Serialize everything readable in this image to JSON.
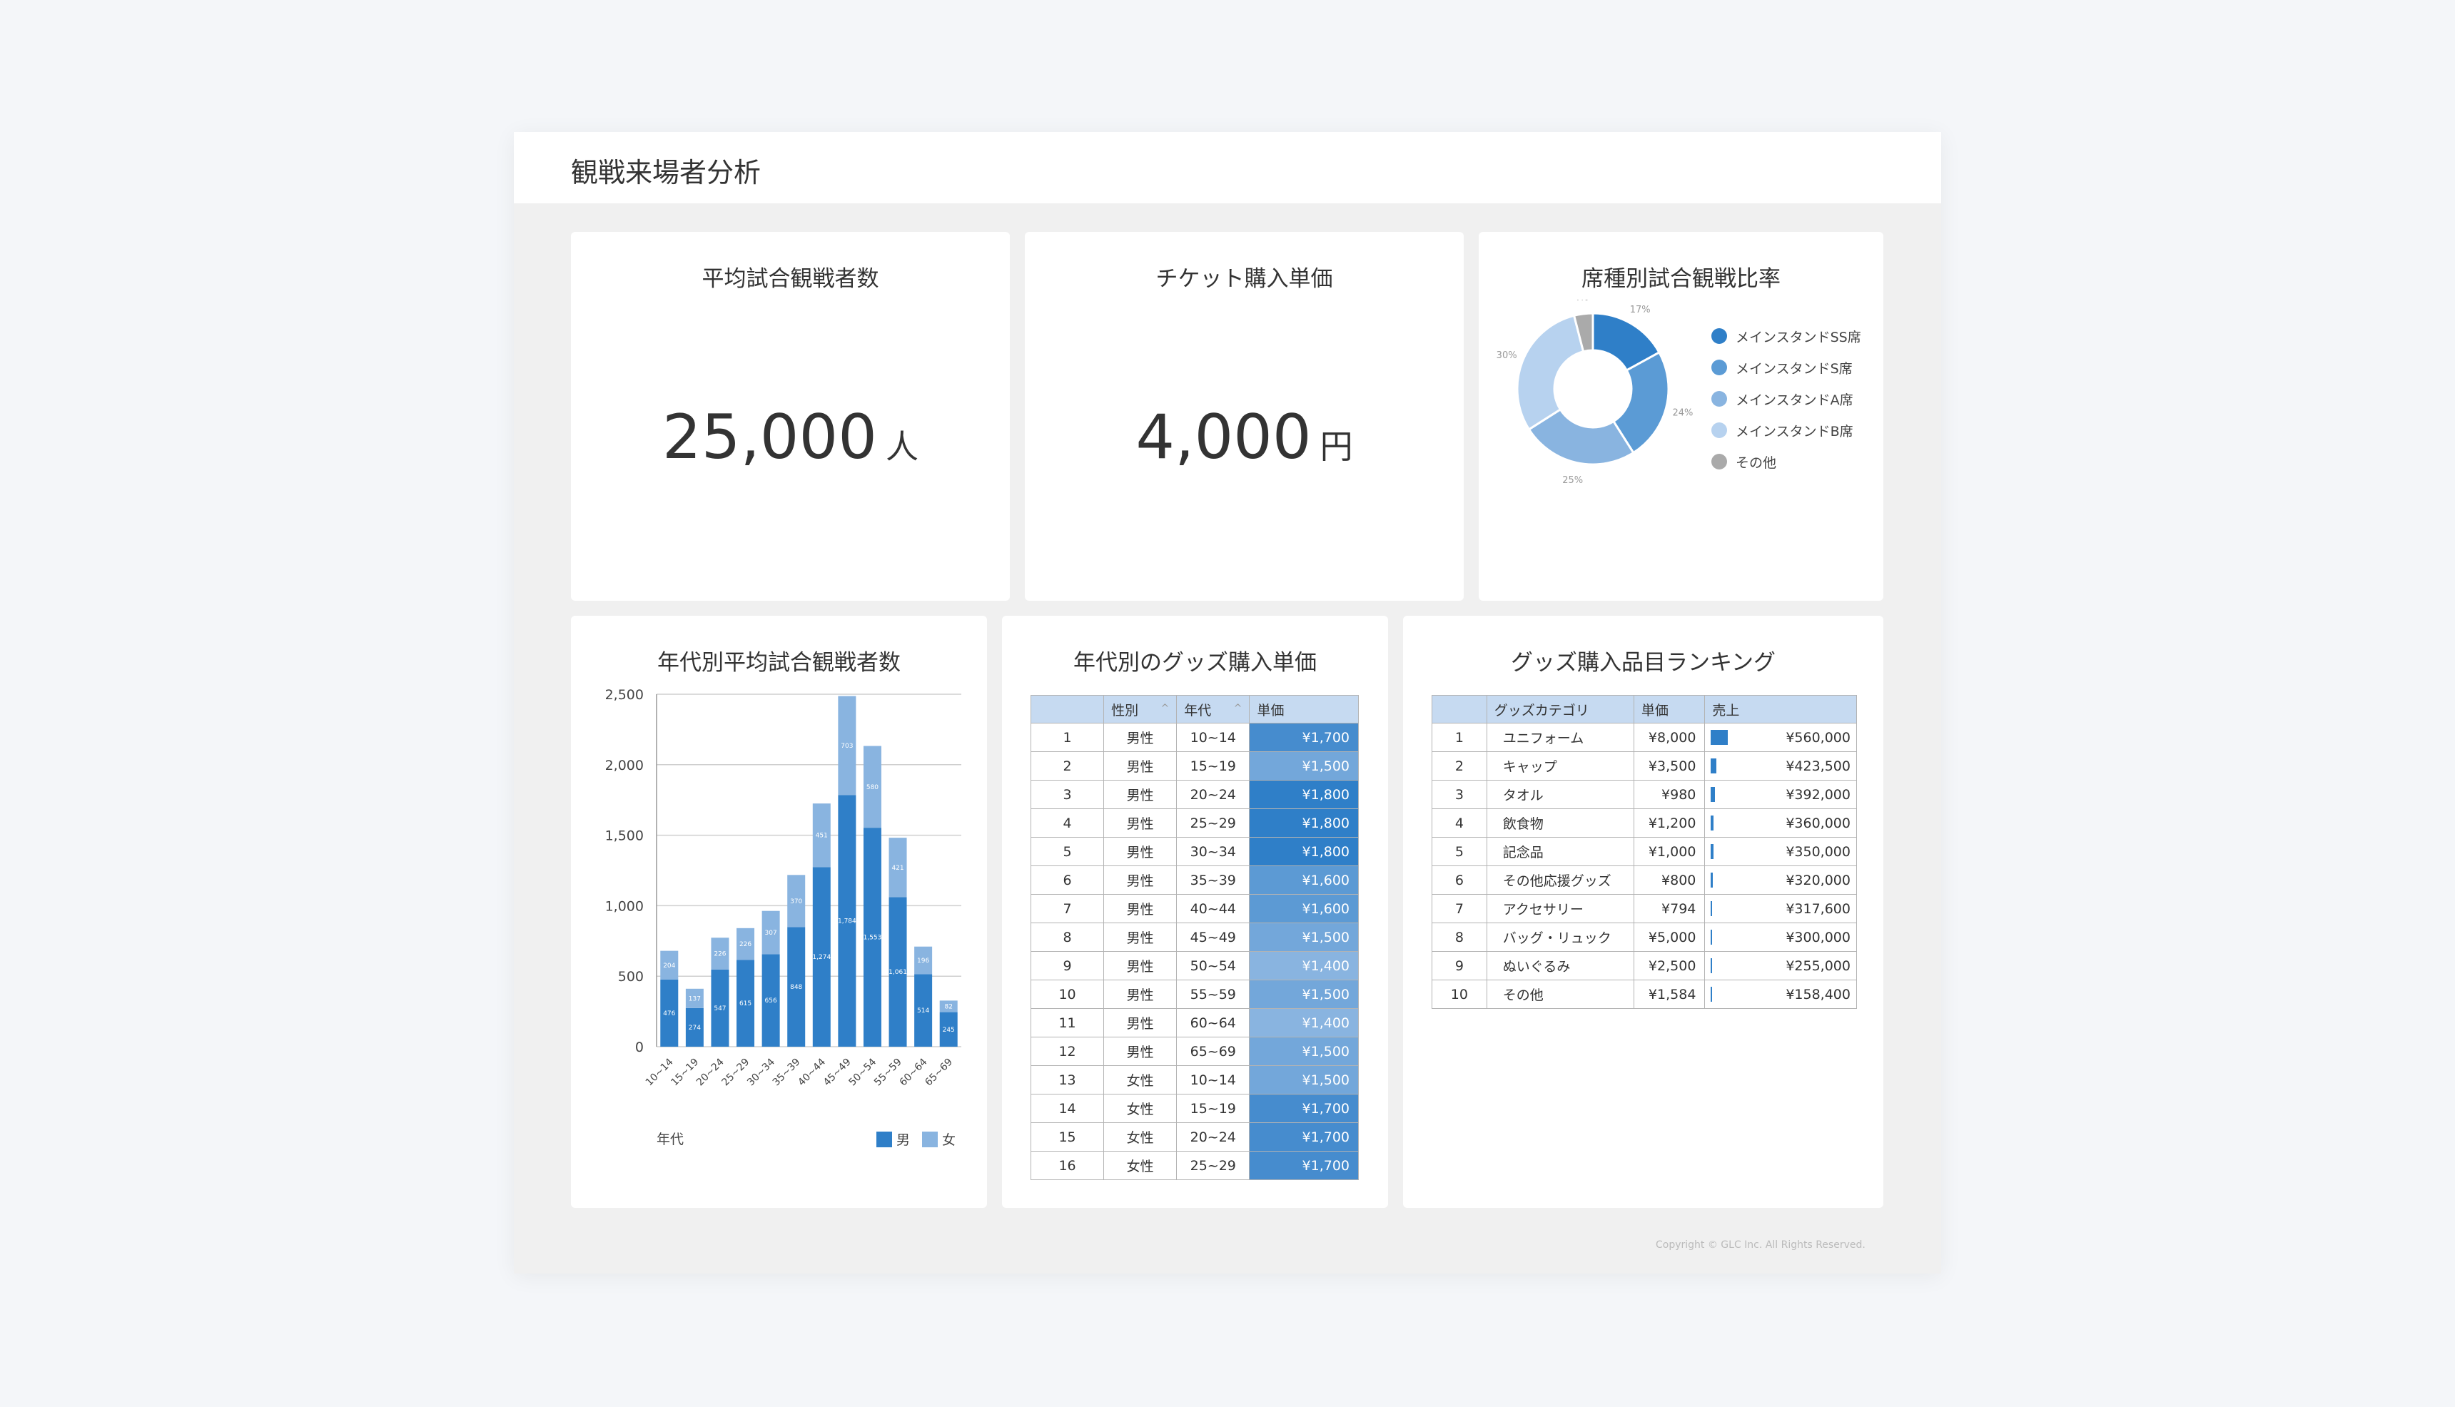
{
  "header": {
    "title": "観戦来場者分析"
  },
  "kpi_attendance": {
    "title": "平均試合観戦者数",
    "value": "25,000",
    "unit": "人"
  },
  "kpi_ticket": {
    "title": "チケット購入単価",
    "value": "4,000",
    "unit": "円"
  },
  "seat_ratio": {
    "title": "席種別試合観戦比率",
    "chart_data": {
      "type": "pie",
      "slices": [
        {
          "name": "メインスタンドSS席",
          "value": 17,
          "label": "17%",
          "color": "#2f7fc8"
        },
        {
          "name": "メインスタンドS席",
          "value": 24,
          "label": "24%",
          "color": "#5b9bd5"
        },
        {
          "name": "メインスタンドA席",
          "value": 25,
          "label": "25%",
          "color": "#89b4e0"
        },
        {
          "name": "メインスタンドB席",
          "value": 30,
          "label": "30%",
          "color": "#b7d2ef"
        },
        {
          "name": "その他",
          "value": 4,
          "label": "4%",
          "color": "#aaaaaa"
        }
      ],
      "legend_position": "right"
    }
  },
  "age_attendance": {
    "title": "年代別平均試合観戦者数",
    "chart_data": {
      "type": "bar",
      "stacked": true,
      "categories": [
        "10~14",
        "15~19",
        "20~24",
        "25~29",
        "30~34",
        "35~39",
        "40~44",
        "45~49",
        "50~54",
        "55~59",
        "60~64",
        "65~69"
      ],
      "series": [
        {
          "name": "男",
          "color": "#2f7fc8",
          "values": [
            476,
            274,
            547,
            615,
            656,
            848,
            1274,
            1784,
            1553,
            1061,
            514,
            245
          ],
          "labels": [
            "476",
            "274",
            "547",
            "615",
            "656",
            "848",
            "1,274",
            "1,784",
            "1,553",
            "1,061",
            "514",
            "245"
          ]
        },
        {
          "name": "女",
          "color": "#89b4e0",
          "values": [
            204,
            137,
            226,
            226,
            307,
            370,
            451,
            703,
            580,
            421,
            196,
            82
          ],
          "labels": [
            "204",
            "137",
            "226",
            "226",
            "307",
            "370",
            "451",
            "703",
            "580",
            "421",
            "196",
            "82"
          ]
        }
      ],
      "xlabel": "年代",
      "ylim": [
        0,
        2500
      ],
      "yticks": [
        "0",
        "500",
        "1,000",
        "1,500",
        "2,000",
        "2,500"
      ],
      "grid": true,
      "legend_position": "bottom-right"
    }
  },
  "goods_by_age": {
    "title": "年代別のグッズ購入単価",
    "columns": [
      "",
      "性別",
      "年代",
      "単価"
    ],
    "rows": [
      [
        "1",
        "男性",
        "10~14",
        "¥1,700",
        1700
      ],
      [
        "2",
        "男性",
        "15~19",
        "¥1,500",
        1500
      ],
      [
        "3",
        "男性",
        "20~24",
        "¥1,800",
        1800
      ],
      [
        "4",
        "男性",
        "25~29",
        "¥1,800",
        1800
      ],
      [
        "5",
        "男性",
        "30~34",
        "¥1,800",
        1800
      ],
      [
        "6",
        "男性",
        "35~39",
        "¥1,600",
        1600
      ],
      [
        "7",
        "男性",
        "40~44",
        "¥1,600",
        1600
      ],
      [
        "8",
        "男性",
        "45~49",
        "¥1,500",
        1500
      ],
      [
        "9",
        "男性",
        "50~54",
        "¥1,400",
        1400
      ],
      [
        "10",
        "男性",
        "55~59",
        "¥1,500",
        1500
      ],
      [
        "11",
        "男性",
        "60~64",
        "¥1,400",
        1400
      ],
      [
        "12",
        "男性",
        "65~69",
        "¥1,500",
        1500
      ],
      [
        "13",
        "女性",
        "10~14",
        "¥1,500",
        1500
      ],
      [
        "14",
        "女性",
        "15~19",
        "¥1,700",
        1700
      ],
      [
        "15",
        "女性",
        "20~24",
        "¥1,700",
        1700
      ],
      [
        "16",
        "女性",
        "25~29",
        "¥1,700",
        1700
      ]
    ]
  },
  "goods_ranking": {
    "title": "グッズ購入品目ランキング",
    "columns": [
      "",
      "グッズカテゴリ",
      "単価",
      "売上"
    ],
    "rows": [
      [
        "1",
        "ユニフォーム",
        "¥8,000",
        "¥560,000",
        560000
      ],
      [
        "2",
        "キャップ",
        "¥3,500",
        "¥423,500",
        423500
      ],
      [
        "3",
        "タオル",
        "¥980",
        "¥392,000",
        392000
      ],
      [
        "4",
        "飲食物",
        "¥1,200",
        "¥360,000",
        360000
      ],
      [
        "5",
        "記念品",
        "¥1,000",
        "¥350,000",
        350000
      ],
      [
        "6",
        "その他応援グッズ",
        "¥800",
        "¥320,000",
        320000
      ],
      [
        "7",
        "アクセサリー",
        "¥794",
        "¥317,600",
        317600
      ],
      [
        "8",
        "バッグ・リュック",
        "¥5,000",
        "¥300,000",
        300000
      ],
      [
        "9",
        "ぬいぐるみ",
        "¥2,500",
        "¥255,000",
        255000
      ],
      [
        "10",
        "その他",
        "¥1,584",
        "¥158,400",
        158400
      ]
    ]
  },
  "footer": {
    "copyright": "Copyright © GLC Inc. All Rights Reserved."
  }
}
